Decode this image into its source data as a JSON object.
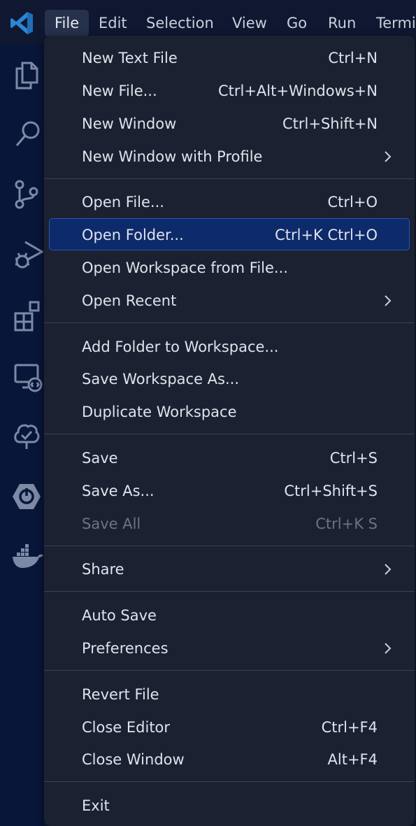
{
  "colors": {
    "accent": "#2b86d6",
    "menu_bg": "#1b2130",
    "highlight": "#0d2a6b",
    "activity_icon": "#7d8aa6"
  },
  "menubar": {
    "logo_icon": "vscode-logo-icon",
    "items": [
      "File",
      "Edit",
      "Selection",
      "View",
      "Go",
      "Run",
      "Termi"
    ]
  },
  "activitybar": {
    "icons": [
      "explorer-icon",
      "search-icon",
      "source-control-icon",
      "run-debug-icon",
      "extensions-icon",
      "remote-explorer-icon",
      "testing-tree-icon",
      "spring-boot-icon",
      "docker-icon"
    ]
  },
  "file_menu": {
    "items": [
      {
        "label": "New Text File",
        "key": "Ctrl+N"
      },
      {
        "label": "New File...",
        "key": "Ctrl+Alt+Windows+N"
      },
      {
        "label": "New Window",
        "key": "Ctrl+Shift+N"
      },
      {
        "label": "New Window with Profile",
        "key": ""
      },
      {
        "label": "Open File...",
        "key": "Ctrl+O"
      },
      {
        "label": "Open Folder...",
        "key": "Ctrl+K Ctrl+O"
      },
      {
        "label": "Open Workspace from File...",
        "key": ""
      },
      {
        "label": "Open Recent",
        "key": ""
      },
      {
        "label": "Add Folder to Workspace...",
        "key": ""
      },
      {
        "label": "Save Workspace As...",
        "key": ""
      },
      {
        "label": "Duplicate Workspace",
        "key": ""
      },
      {
        "label": "Save",
        "key": "Ctrl+S"
      },
      {
        "label": "Save As...",
        "key": "Ctrl+Shift+S"
      },
      {
        "label": "Save All",
        "key": "Ctrl+K S"
      },
      {
        "label": "Share",
        "key": ""
      },
      {
        "label": "Auto Save",
        "key": ""
      },
      {
        "label": "Preferences",
        "key": ""
      },
      {
        "label": "Revert File",
        "key": ""
      },
      {
        "label": "Close Editor",
        "key": "Ctrl+F4"
      },
      {
        "label": "Close Window",
        "key": "Alt+F4"
      },
      {
        "label": "Exit",
        "key": ""
      }
    ]
  }
}
